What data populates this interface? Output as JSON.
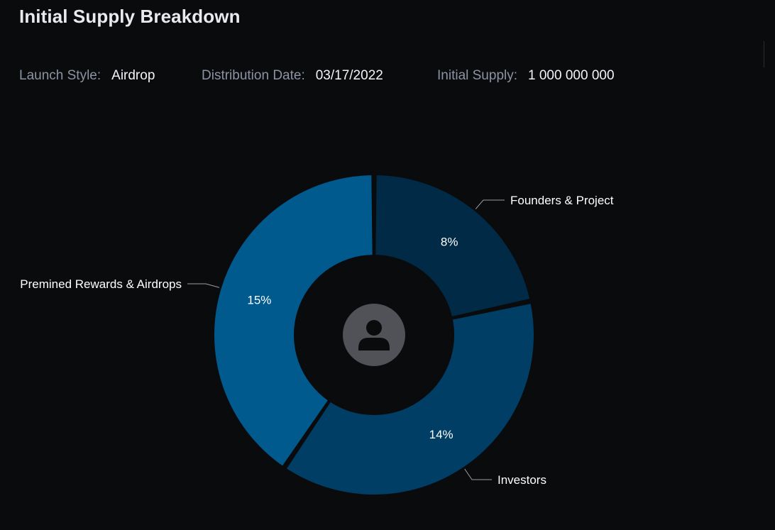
{
  "page": {
    "title": "Initial Supply Breakdown"
  },
  "meta": {
    "launch_style_label": "Launch Style:",
    "launch_style_value": "Airdrop",
    "distribution_date_label": "Distribution Date:",
    "distribution_date_value": "03/17/2022",
    "initial_supply_label": "Initial Supply:",
    "initial_supply_value": "1 000 000 000"
  },
  "center_icon": "user-avatar-icon",
  "chart_data": {
    "type": "pie",
    "style": "donut",
    "categories": [
      "Founders & Project",
      "Investors",
      "Premined Rewards & Airdrops"
    ],
    "values": [
      8,
      14,
      15
    ],
    "value_labels": [
      "8%",
      "14%",
      "15%"
    ],
    "colors": [
      "#002a46",
      "#003e66",
      "#005a8e"
    ],
    "background": "#0a0b0d",
    "legend": "none"
  }
}
